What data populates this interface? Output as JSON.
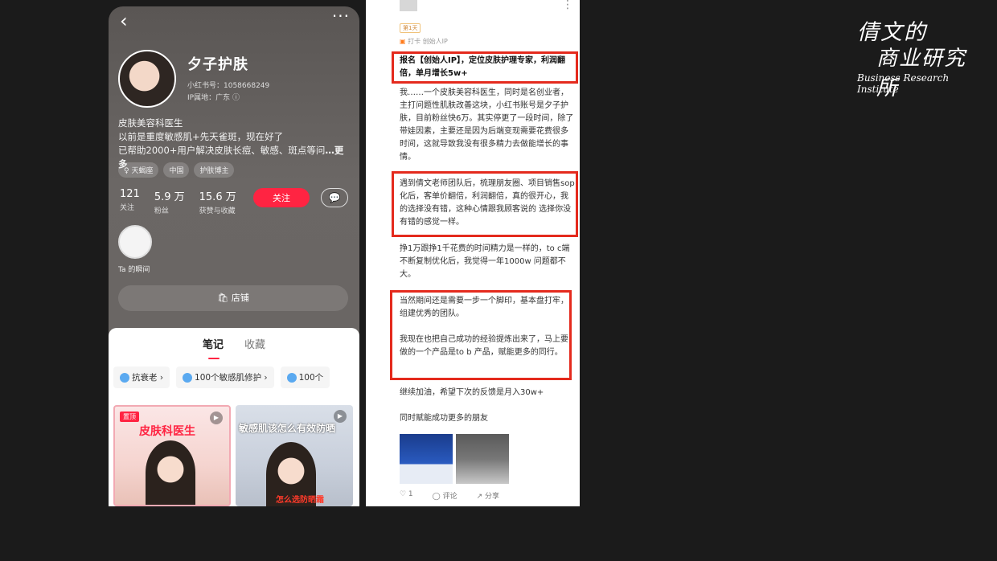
{
  "left_phone": {
    "back_icon": "chevron-left-icon",
    "more_icon": "more-horizontal-icon",
    "name": "夕子护肤",
    "xhs_id": "小红书号：1058668249",
    "ip_location": "IP属地：广东 ⓘ",
    "bio_lines": [
      "皮肤美容科医生",
      "以前是重度敏感肌+先天雀斑，现在好了",
      "已帮助2000+用户解决皮肤长痘、敏感、斑点等问"
    ],
    "bio_more": "…更多",
    "tags": [
      "♀ 天蝎座",
      "中国",
      "护肤博主"
    ],
    "stats": [
      {
        "num": "121",
        "label": "关注"
      },
      {
        "num": "5.9 万",
        "label": "粉丝"
      },
      {
        "num": "15.6 万",
        "label": "获赞与收藏"
      }
    ],
    "follow_label": "关注",
    "moment_label": "Ta 的瞬间",
    "store_label": "店铺",
    "tabs": [
      "笔记",
      "收藏"
    ],
    "chips": [
      "抗衰老 ›",
      "100个敏感肌修护 ›",
      "100个"
    ],
    "cards": [
      {
        "badge": "置顶",
        "title": "皮肤科医生",
        "sub": ""
      },
      {
        "badge": "",
        "title": "敏感肌该怎么有效防晒",
        "sub": "怎么选防晒霜"
      }
    ]
  },
  "right_phone": {
    "day_badge": "第1天",
    "checkin": "打卡  创始人IP",
    "paragraphs": [
      {
        "text": "报名【创始人IP】，定位皮肤护理专家，利润翻倍，单月增长5w+",
        "bold": true
      },
      {
        "text": "我……一个皮肤美容科医生，同时是名创业者，主打问题性肌肤改善这块，小红书账号是夕子护肤，目前粉丝快6万。其实停更了一段时间，除了带娃因素，主要还是因为后端变现需要花费很多时间，这就导致我没有很多精力去做能增长的事情。",
        "bold": false
      },
      {
        "text": "遇到倩文老师团队后，梳理朋友圈、项目销售sop化后，客单价翻倍，利润翻倍，真的很开心，我的选择没有错，这种心情跟我顾客说的 选择你没有错的感觉一样。",
        "bold": false
      },
      {
        "text": "挣1万跟挣1千花费的时间精力是一样的，to c端不断复制优化后，我觉得一年1000w 问题都不大。",
        "bold": false
      },
      {
        "text": "当然期间还是需要一步一个脚印，基本盘打牢，组建优秀的团队。",
        "bold": false
      },
      {
        "text": "我现在也把自己成功的经验提炼出来了，马上要做的一个产品是to b 产品，赋能更多的同行。",
        "bold": false
      },
      {
        "text": "继续加油，希望下次的反馈是月入30w+",
        "bold": false
      },
      {
        "text": "同时赋能成功更多的朋友",
        "bold": false
      }
    ],
    "actions": [
      "♡ 1",
      "◯ 评论",
      "↗ 分享"
    ]
  },
  "brand": {
    "line1": "倩文的",
    "line2": "商业研究所",
    "line3": "Business Research Institute"
  }
}
